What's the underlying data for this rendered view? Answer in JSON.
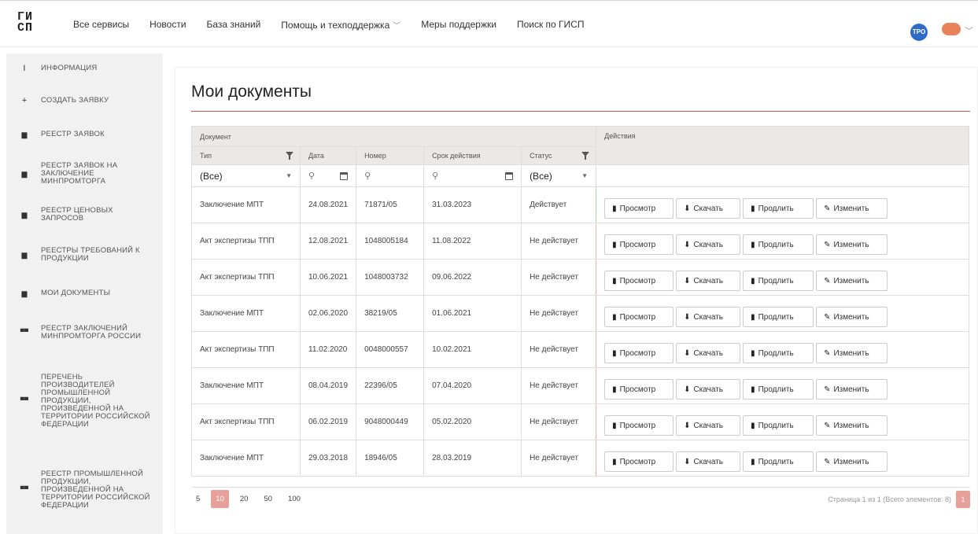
{
  "header": {
    "logo_text": "ГИСП",
    "nav": [
      "Все сервисы",
      "Новости",
      "База знаний",
      "Помощь и техподдержка",
      "Меры поддержки",
      "Поиск по ГИСП"
    ],
    "avatar": "ТРО"
  },
  "sidebar": {
    "items": [
      {
        "icon": "info-icon",
        "label": "Информация"
      },
      {
        "icon": "plus-icon",
        "label": "Создать заявку"
      },
      {
        "icon": "doc-icon",
        "label": "Реестр заявок"
      },
      {
        "icon": "doc-icon",
        "label": "Реестр заявок на заключение Минпромторга"
      },
      {
        "icon": "doc-icon",
        "label": "Реестр ценовых запросов"
      },
      {
        "icon": "doc-icon",
        "label": "Реестры требований к продукции"
      },
      {
        "icon": "doc-icon",
        "label": "Мои документы"
      },
      {
        "icon": "book-icon",
        "label": "Реестр заключений Минпромторга России"
      },
      {
        "icon": "book-icon",
        "label": "Перечень производителей промышленной продукции, произведенной на территории Российской Федерации"
      },
      {
        "icon": "book-icon",
        "label": "Реестр промышленной продукции, произведенной на территории Российской Федерации"
      }
    ]
  },
  "page": {
    "title": "Мои документы"
  },
  "table": {
    "group_doc": "Документ",
    "group_actions": "Действия",
    "cols": {
      "type": "Тип",
      "date": "Дата",
      "number": "Номер",
      "valid": "Срок действия",
      "status": "Статус"
    },
    "filters": {
      "type": "(Все)",
      "status": "(Все)"
    },
    "rows": [
      {
        "type": "Заключение МПТ",
        "date": "24.08.2021",
        "number": "71871/05",
        "valid": "31.03.2023",
        "status": "Действует"
      },
      {
        "type": "Акт экспертизы ТПП",
        "date": "12.08.2021",
        "number": "1048005184",
        "valid": "11.08.2022",
        "status": "Не действует"
      },
      {
        "type": "Акт экспертизы ТПП",
        "date": "10.06.2021",
        "number": "1048003732",
        "valid": "09.06.2022",
        "status": "Не действует"
      },
      {
        "type": "Заключение МПТ",
        "date": "02.06.2020",
        "number": "38219/05",
        "valid": "01.06.2021",
        "status": "Не действует"
      },
      {
        "type": "Акт экспертизы ТПП",
        "date": "11.02.2020",
        "number": "0048000557",
        "valid": "10.02.2021",
        "status": "Не действует"
      },
      {
        "type": "Заключение МПТ",
        "date": "08.04.2019",
        "number": "22396/05",
        "valid": "07.04.2020",
        "status": "Не действует"
      },
      {
        "type": "Акт экспертизы ТПП",
        "date": "06.02.2019",
        "number": "9048000449",
        "valid": "05.02.2020",
        "status": "Не действует"
      },
      {
        "type": "Заключение МПТ",
        "date": "29.03.2018",
        "number": "18946/05",
        "valid": "28.03.2019",
        "status": "Не действует"
      }
    ],
    "actions": [
      "Просмотр",
      "Скачать",
      "Продлить",
      "Изменить"
    ]
  },
  "pager": {
    "sizes": [
      "5",
      "10",
      "20",
      "50",
      "100"
    ],
    "active_size": "10",
    "info": "Страница 1 из 1 (Всего элементов: 8)",
    "page": "1"
  },
  "colors": {
    "accent": "#c9534a",
    "pager_active": "#e8a09a",
    "avatar": "#2e6bc7"
  }
}
